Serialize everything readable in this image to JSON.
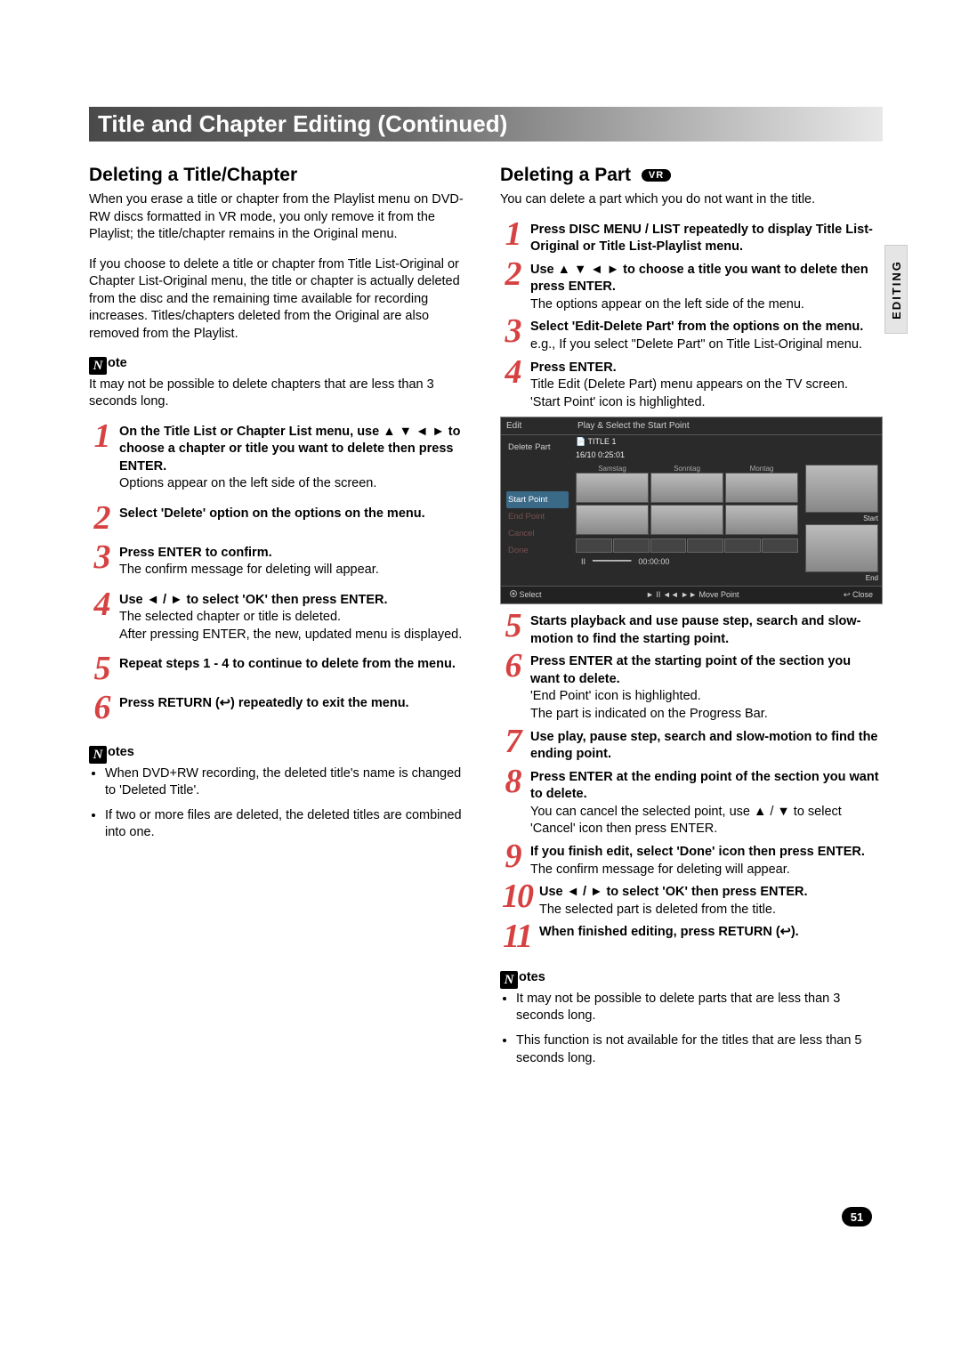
{
  "header": "Title and Chapter Editing (Continued)",
  "sideTab": "EDITING",
  "pageNum": "51",
  "left": {
    "h2": "Deleting a Title/Chapter",
    "p1": "When you erase a title or chapter from the Playlist menu on DVD-RW discs formatted in VR mode, you only remove it from the Playlist; the title/chapter remains in the Original menu.",
    "p2": "If you choose to delete a title or chapter from Title List-Original or Chapter List-Original menu, the title or chapter is actually deleted from the disc and the remaining time available for recording increases. Titles/chapters deleted from the Original are also removed from the Playlist.",
    "noteH": "ote",
    "noteP": "It may not be possible to delete chapters that are less than 3 seconds long.",
    "steps": [
      {
        "n": "1",
        "b": "On the Title List or Chapter List menu, use ▲ ▼ ◄ ► to choose a chapter or title you want to delete then press ENTER.",
        "t": "Options appear on the left side of the screen."
      },
      {
        "n": "2",
        "b": "Select 'Delete' option on the options on the menu.",
        "t": ""
      },
      {
        "n": "3",
        "b": "Press ENTER to confirm.",
        "t": "The confirm message for deleting will appear."
      },
      {
        "n": "4",
        "b": "Use ◄ / ► to select 'OK' then press ENTER.",
        "t": "The selected chapter or title is deleted.\nAfter pressing ENTER, the new, updated menu is displayed."
      },
      {
        "n": "5",
        "b": "Repeat steps 1 - 4 to continue to delete from the menu.",
        "t": ""
      },
      {
        "n": "6",
        "b": "Press RETURN (↩) repeatedly to exit the menu.",
        "t": ""
      }
    ],
    "notesH": "otes",
    "notes": [
      "When DVD+RW recording, the deleted title's name is changed to 'Deleted Title'.",
      "If two or more files are deleted, the deleted titles are combined into one."
    ]
  },
  "right": {
    "h2": "Deleting a Part",
    "badge": "VR",
    "p1": "You can delete a part which you do not want in the title.",
    "stepsTop": [
      {
        "n": "1",
        "b": "Press DISC MENU / LIST repeatedly to display Title List-Original or Title List-Playlist menu.",
        "t": ""
      },
      {
        "n": "2",
        "b": "Use ▲ ▼ ◄ ► to choose a title you want to delete then press ENTER.",
        "t": "The options appear on the left side of the menu."
      },
      {
        "n": "3",
        "b": "Select 'Edit-Delete Part' from the options on the menu.",
        "t": "e.g., If you select \"Delete Part\" on Title List-Original menu."
      },
      {
        "n": "4",
        "b": "Press ENTER.",
        "t": "Title Edit (Delete Part) menu appears on the TV screen.\n'Start Point' icon is highlighted."
      }
    ],
    "tv": {
      "edit": "Edit",
      "topMsg": "Play & Select the Start Point",
      "side": [
        "Delete Part",
        "Start Point",
        "End Point",
        "Cancel",
        "Done"
      ],
      "titleLine1": "TITLE 1",
      "titleLine2": "16/10    0:25:01",
      "days": [
        "Samstag",
        "Sonntag",
        "Montag"
      ],
      "labelStart": "Start",
      "labelEnd": "End",
      "pause": "II",
      "time": "00:00:00",
      "bSelect": "Select",
      "bMove": "► II ◄◄ ►► Move Point",
      "bClose": "↩ Close"
    },
    "stepsBottom": [
      {
        "n": "5",
        "b": "Starts playback and use pause step, search and slow-motion to find the starting point.",
        "t": ""
      },
      {
        "n": "6",
        "b": "Press ENTER at the starting point of the section you want to delete.",
        "t": "'End Point' icon is highlighted.\nThe part is indicated on the Progress Bar."
      },
      {
        "n": "7",
        "b": "Use play, pause step, search and slow-motion to find the ending point.",
        "t": ""
      },
      {
        "n": "8",
        "b": "Press ENTER at the ending point of the section you want to delete.",
        "t": "You can cancel the selected point, use ▲ / ▼ to select 'Cancel' icon then press ENTER."
      },
      {
        "n": "9",
        "b": "If you finish edit, select 'Done' icon then press ENTER.",
        "t": "The confirm message for deleting will appear."
      },
      {
        "n": "10",
        "b": "Use ◄ / ► to select 'OK' then press ENTER.",
        "t": "The selected part is deleted from the title."
      },
      {
        "n": "11",
        "b": "When finished editing, press RETURN (↩).",
        "t": ""
      }
    ],
    "notesH": "otes",
    "notes": [
      "It may not be possible to delete parts that are less than 3 seconds long.",
      "This function is not available for the titles that are less than 5 seconds long."
    ]
  }
}
